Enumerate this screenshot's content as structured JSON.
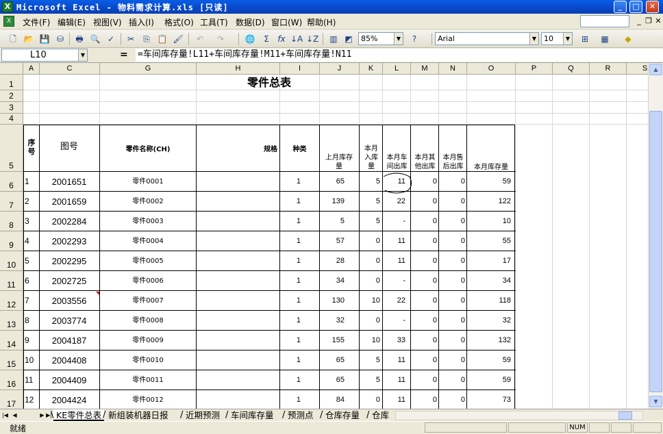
{
  "title_bar": {
    "text": "Microsoft Excel - 物料需求计算.xls  [只读]",
    "app_icon": "X"
  },
  "window_controls": {
    "minimize": "_",
    "maximize": "□",
    "close": "✕"
  },
  "menu": {
    "items": [
      "文件(F)",
      "编辑(E)",
      "视图(V)",
      "插入(I)",
      "格式(O)",
      "工具(T)",
      "数据(D)",
      "窗口(W)",
      "帮助(H)"
    ],
    "help_placeholder": ""
  },
  "toolbar": {
    "zoom": "85%",
    "font_name": "Arial",
    "font_size": "10",
    "help_button": "?"
  },
  "formula_bar": {
    "name_box": "L10",
    "fx": "=",
    "formula": "=车间库存量!L11+车间库存量!M11+车间库存量!N11"
  },
  "columns": [
    "A",
    "C",
    "G",
    "H",
    "I",
    "J",
    "K",
    "L",
    "M",
    "N",
    "O",
    "P",
    "Q",
    "R",
    "S"
  ],
  "rows": [
    "1",
    "2",
    "3",
    "4",
    "5",
    "6",
    "7",
    "8",
    "9",
    "10",
    "11",
    "12",
    "13",
    "14",
    "15",
    "16",
    "17"
  ],
  "sheet": {
    "title": "零件总表",
    "headers": {
      "seq": "序号",
      "drawing_no": "图号",
      "part_name": "零件名称(CH)",
      "spec": "规格",
      "type": "种类",
      "last_stock": "上月库存量",
      "month_in": "本月入库量",
      "workshop_out": "本月车间出库",
      "other_out": "本月其他出库",
      "after_sale_out": "本月售后出库",
      "month_stock": "本月库存量"
    },
    "data_rows": [
      {
        "seq": "1",
        "drawing": "2001651",
        "name": "零件0001",
        "type": "1",
        "last": "65",
        "in": "5",
        "ws": "11",
        "other": "0",
        "after": "0",
        "stock": "59"
      },
      {
        "seq": "2",
        "drawing": "2001659",
        "name": "零件0002",
        "type": "1",
        "last": "139",
        "in": "5",
        "ws": "22",
        "other": "0",
        "after": "0",
        "stock": "122"
      },
      {
        "seq": "3",
        "drawing": "2002284",
        "name": "零件0003",
        "type": "1",
        "last": "5",
        "in": "5",
        "ws": "-",
        "other": "0",
        "after": "0",
        "stock": "10"
      },
      {
        "seq": "4",
        "drawing": "2002293",
        "name": "零件0004",
        "type": "1",
        "last": "57",
        "in": "0",
        "ws": "11",
        "other": "0",
        "after": "0",
        "stock": "55"
      },
      {
        "seq": "5",
        "drawing": "2002295",
        "name": "零件0005",
        "type": "1",
        "last": "28",
        "in": "0",
        "ws": "11",
        "other": "0",
        "after": "0",
        "stock": "17"
      },
      {
        "seq": "6",
        "drawing": "2002725",
        "name": "零件0006",
        "type": "1",
        "last": "34",
        "in": "0",
        "ws": "-",
        "other": "0",
        "after": "0",
        "stock": "34"
      },
      {
        "seq": "7",
        "drawing": "2003556",
        "name": "零件0007",
        "type": "1",
        "last": "130",
        "in": "10",
        "ws": "22",
        "other": "0",
        "after": "0",
        "stock": "118"
      },
      {
        "seq": "8",
        "drawing": "2003774",
        "name": "零件0008",
        "type": "1",
        "last": "32",
        "in": "0",
        "ws": "-",
        "other": "0",
        "after": "0",
        "stock": "32"
      },
      {
        "seq": "9",
        "drawing": "2004187",
        "name": "零件0009",
        "type": "1",
        "last": "155",
        "in": "10",
        "ws": "33",
        "other": "0",
        "after": "0",
        "stock": "132"
      },
      {
        "seq": "10",
        "drawing": "2004408",
        "name": "零件0010",
        "type": "1",
        "last": "65",
        "in": "5",
        "ws": "11",
        "other": "0",
        "after": "0",
        "stock": "59"
      },
      {
        "seq": "11",
        "drawing": "2004409",
        "name": "零件0011",
        "type": "1",
        "last": "65",
        "in": "5",
        "ws": "11",
        "other": "0",
        "after": "0",
        "stock": "59"
      },
      {
        "seq": "12",
        "drawing": "2004424",
        "name": "零件0012",
        "type": "1",
        "last": "84",
        "in": "0",
        "ws": "11",
        "other": "0",
        "after": "0",
        "stock": "73"
      }
    ]
  },
  "sheet_tabs": [
    "KE零件总表",
    "新组装机器日报",
    "近期预测",
    "车间库存量",
    "预测点",
    "仓库存量",
    "仓库"
  ],
  "active_sheet": "KE零件总表",
  "status": {
    "ready": "就绪",
    "num": "NUM"
  },
  "colors": {
    "title_bar": "#0a5ee6",
    "comment_marker": "#cc0000"
  }
}
